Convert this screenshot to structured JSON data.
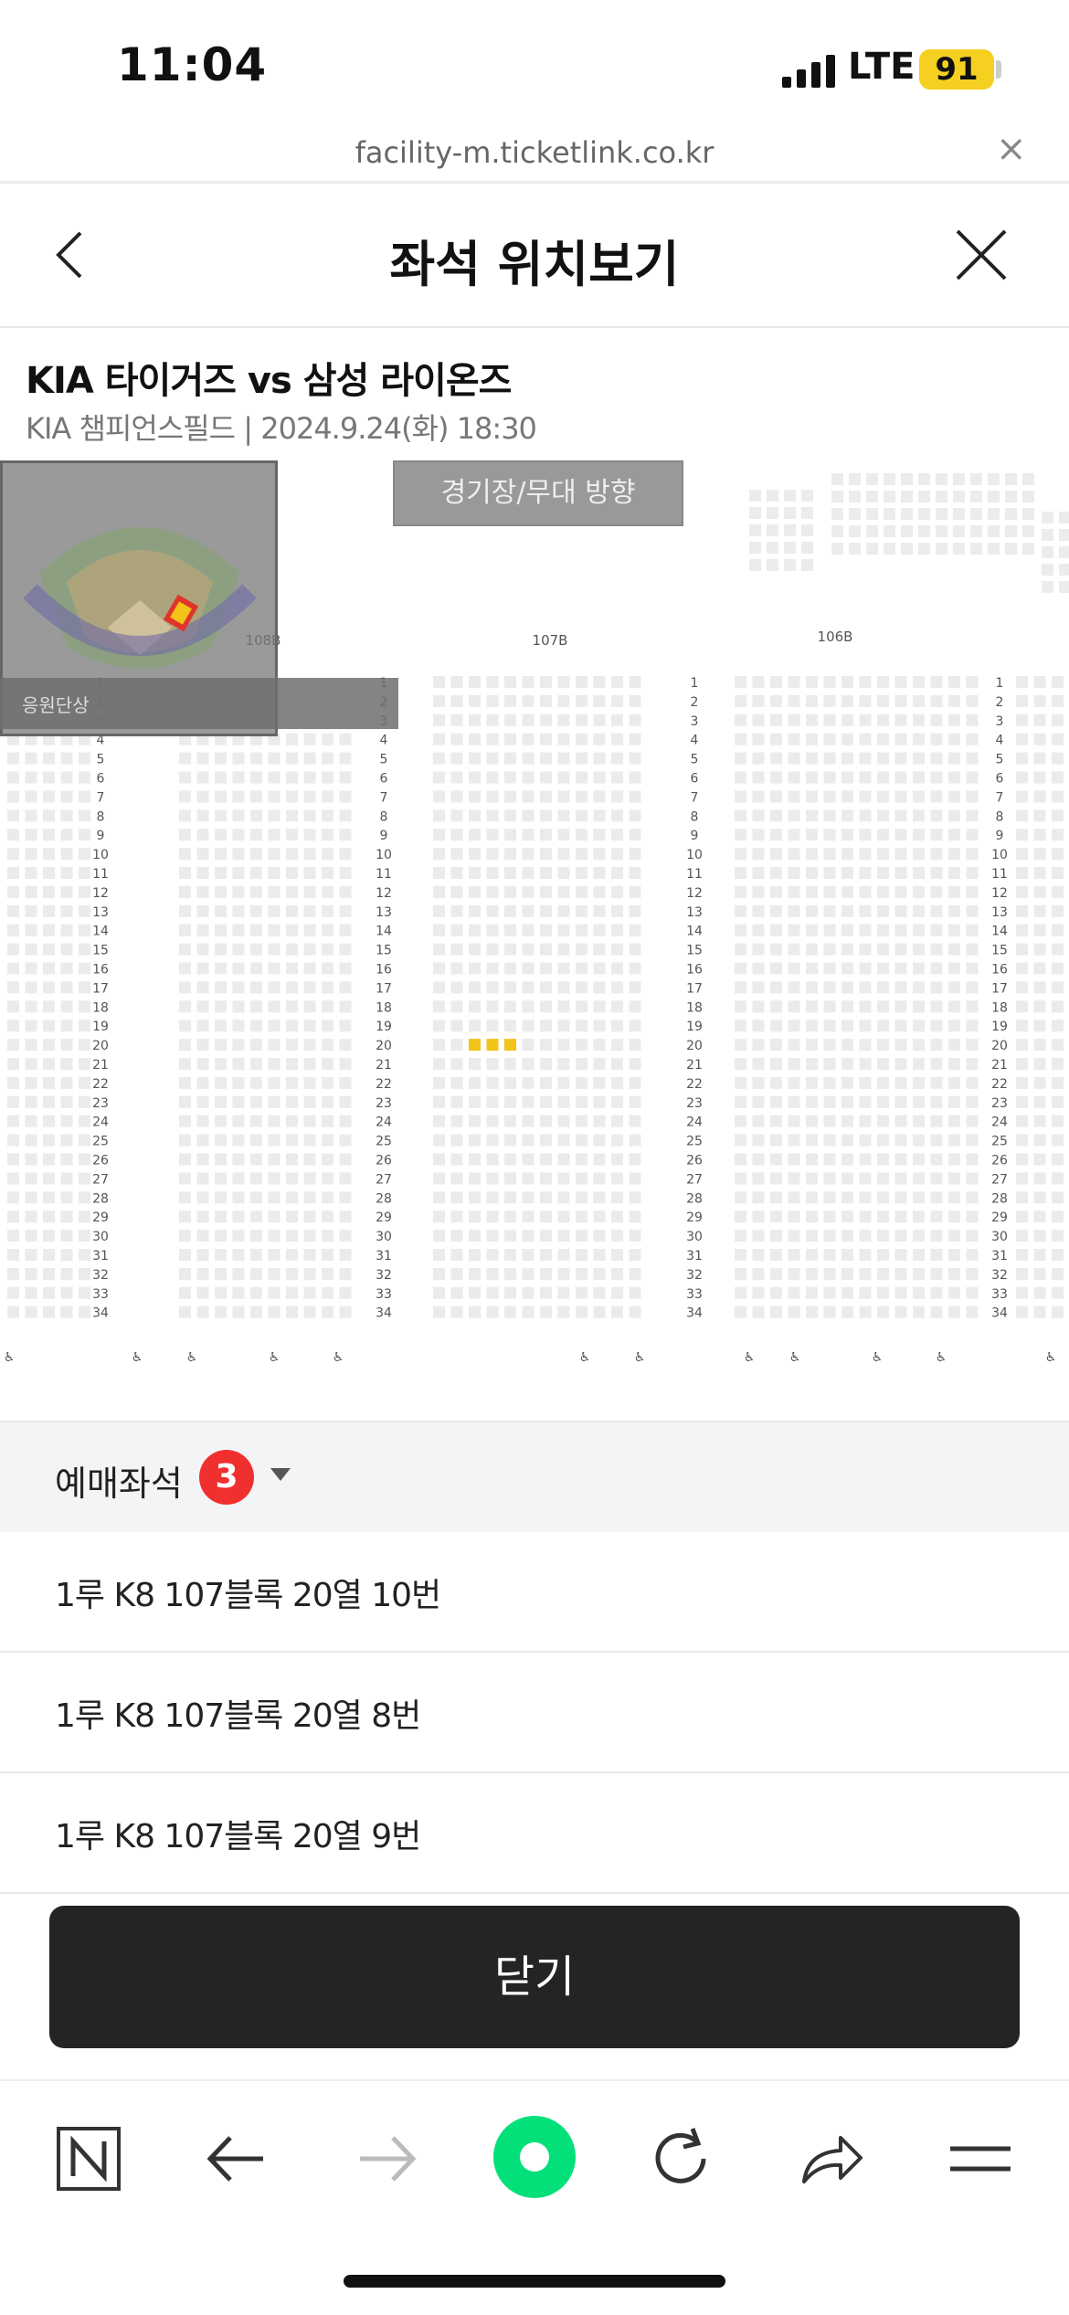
{
  "status_bar": {
    "time": "11:04",
    "network": "LTE",
    "battery": "91"
  },
  "browser": {
    "url": "facility-m.ticketlink.co.kr",
    "close_symbol": "×"
  },
  "header": {
    "title": "좌석 위치보기"
  },
  "match": {
    "title": "KIA 타이거즈 vs 삼성 라이온즈",
    "subtitle": "KIA 챔피언스필드 | 2024.9.24(화) 18:30"
  },
  "seat_map": {
    "stage_label": "경기장/무대 방향",
    "block_labels": [
      "108B",
      "107B",
      "106B"
    ],
    "guide_text": "응원단상",
    "selected_seat_color": "#f2c318",
    "row_numbers": [
      "1",
      "2",
      "3",
      "4",
      "5",
      "6",
      "7",
      "8",
      "9",
      "10",
      "11",
      "12",
      "13",
      "14",
      "15",
      "16",
      "17",
      "18",
      "19",
      "20",
      "21",
      "22",
      "23",
      "24",
      "25",
      "26",
      "27",
      "28",
      "29",
      "30",
      "31",
      "32",
      "33",
      "34"
    ]
  },
  "reserved": {
    "label": "예매좌석",
    "count": "3",
    "seats": [
      "1루 K8 107블록 20열 10번",
      "1루 K8 107블록 20열 8번",
      "1루 K8 107블록 20열 9번"
    ]
  },
  "close_button": "닫기",
  "toolbar": {
    "icons": [
      "naver-home-icon",
      "back-arrow-icon",
      "forward-arrow-icon",
      "green-dot-icon",
      "refresh-icon",
      "share-icon",
      "menu-icon"
    ],
    "accent": "#03e07a"
  }
}
